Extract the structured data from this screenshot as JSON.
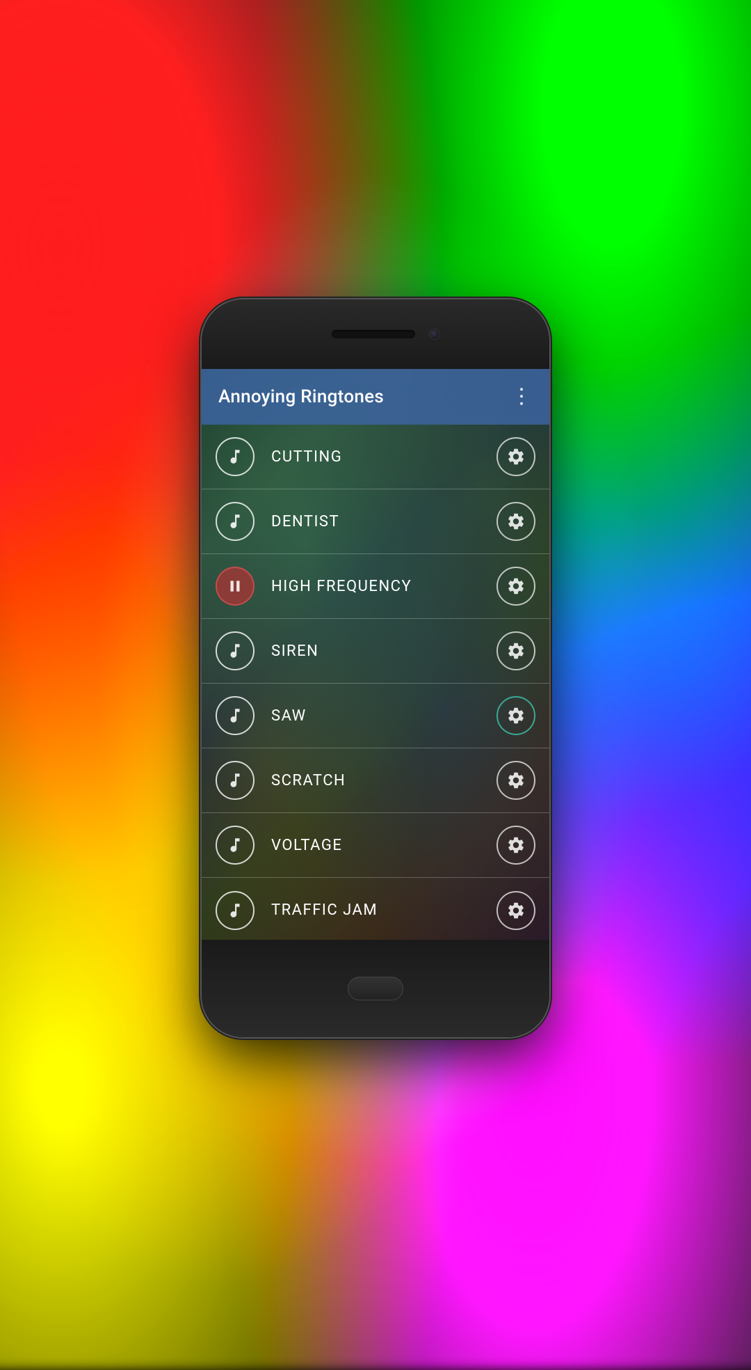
{
  "background": {
    "description": "colorful psychedelic blurred background"
  },
  "phone": {
    "appBar": {
      "title": "Annoying Ringtones",
      "moreMenuLabel": "⋮"
    },
    "ringtones": [
      {
        "id": 1,
        "name": "CUTTING",
        "playing": false,
        "settingsActive": false
      },
      {
        "id": 2,
        "name": "DENTIST",
        "playing": false,
        "settingsActive": false
      },
      {
        "id": 3,
        "name": "HIGH FREQUENCY",
        "playing": true,
        "settingsActive": false
      },
      {
        "id": 4,
        "name": "SIREN",
        "playing": false,
        "settingsActive": false
      },
      {
        "id": 5,
        "name": "SAW",
        "playing": false,
        "settingsActive": true
      },
      {
        "id": 6,
        "name": "SCRATCH",
        "playing": false,
        "settingsActive": false
      },
      {
        "id": 7,
        "name": "VOLTAGE",
        "playing": false,
        "settingsActive": false
      },
      {
        "id": 8,
        "name": "TRAFFIC JAM",
        "playing": false,
        "settingsActive": false
      }
    ]
  }
}
